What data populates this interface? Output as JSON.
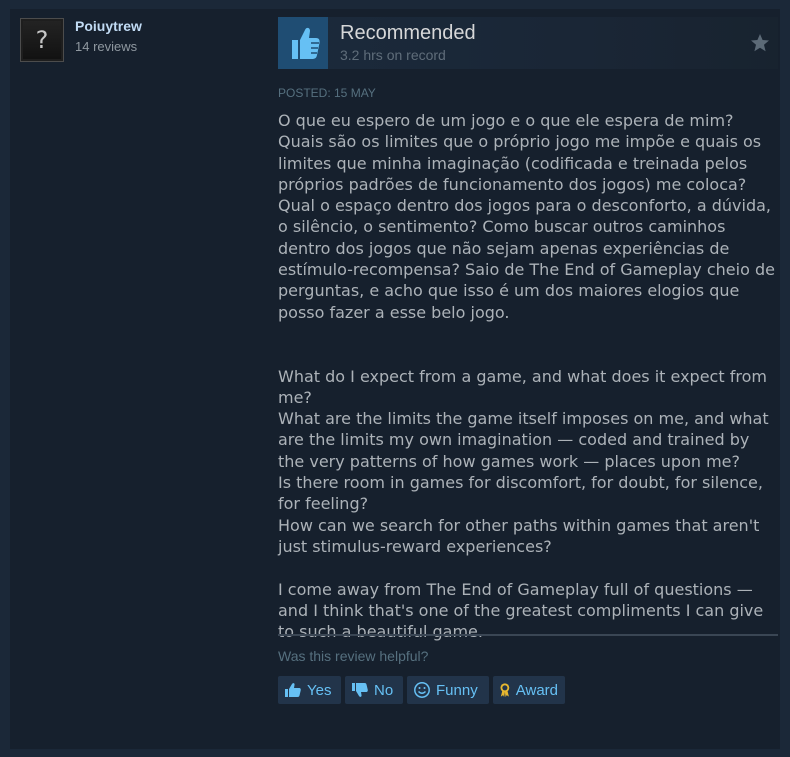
{
  "author": {
    "avatar_glyph": "?",
    "name": "Poiuytrew",
    "reviews": "14 reviews"
  },
  "review": {
    "verdict": "Recommended",
    "hours": "3.2 hrs on record",
    "posted": "Posted: 15 May",
    "body": "O que eu espero de um jogo e o que ele espera de mim? Quais são os limites que o próprio jogo me impõe e quais os limites que minha imaginação (codificada e treinada pelos próprios padrões de funcionamento dos jogos) me coloca? Qual o espaço dentro dos jogos para o desconforto, a dúvida, o silêncio, o sentimento? Como buscar outros caminhos dentro dos jogos que não sejam apenas experiências de estímulo-recompensa? Saio de The End of Gameplay cheio de perguntas, e acho que isso é um dos maiores elogios que posso fazer a esse belo jogo.\n\n\nWhat do I expect from a game, and what does it expect from me?\nWhat are the limits the game itself imposes on me, and what are the limits my own imagination — coded and trained by the very patterns of how games work — places upon me?\nIs there room in games for discomfort, for doubt, for silence, for feeling?\nHow can we search for other paths within games that aren't just stimulus-reward experiences?\n\nI come away from The End of Gameplay full of questions — and I think that's one of the greatest compliments I can give to such a beautiful game."
  },
  "feedback": {
    "prompt": "Was this review helpful?",
    "yes": "Yes",
    "no": "No",
    "funny": "Funny",
    "award": "Award"
  },
  "icons": {
    "thumb": "thumbs-up-icon",
    "star": "star-icon",
    "yes": "thumbs-up-icon",
    "no": "thumbs-down-icon",
    "funny": "smiley-icon",
    "award": "award-ribbon-icon"
  },
  "colors": {
    "background": "#1b2838",
    "card": "#16202d",
    "accent": "#66c0f4",
    "author_name": "#c1dbf4",
    "thumb_box": "#1f4d73",
    "award_gold": "#e8b830"
  }
}
